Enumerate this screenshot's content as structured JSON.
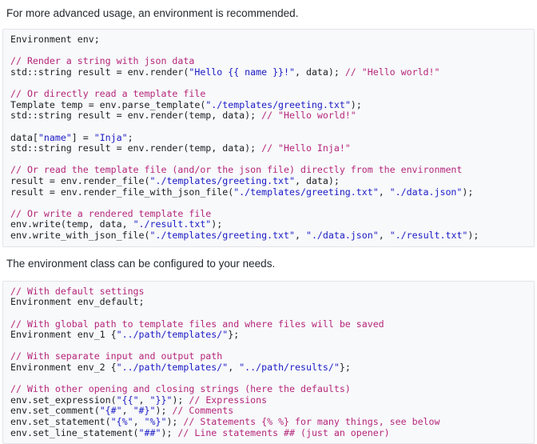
{
  "colors": {
    "comment": "#b5267a",
    "string": "#1a1ac4",
    "code_text": "#1b1f23",
    "body_text": "#24292e",
    "code_background": "#f8f9fb",
    "code_border": "#e2e4e8",
    "page_background": "#ffffff"
  },
  "paragraphs": {
    "intro": "For more advanced usage, an environment is recommended.",
    "configure": "The environment class can be configured to your needs."
  },
  "code_blocks": [
    {
      "name": "environment-usage-example",
      "language": "cpp",
      "lines": [
        [
          {
            "t": "p",
            "v": "Environment env;"
          }
        ],
        [],
        [
          {
            "t": "c",
            "v": "// Render a string with json data"
          }
        ],
        [
          {
            "t": "p",
            "v": "std::string result = env.render("
          },
          {
            "t": "s",
            "v": "\"Hello {{ name }}!\""
          },
          {
            "t": "p",
            "v": ", data); "
          },
          {
            "t": "c",
            "v": "// \"Hello world!\""
          }
        ],
        [],
        [
          {
            "t": "c",
            "v": "// Or directly read a template file"
          }
        ],
        [
          {
            "t": "p",
            "v": "Template temp = env.parse_template("
          },
          {
            "t": "s",
            "v": "\"./templates/greeting.txt\""
          },
          {
            "t": "p",
            "v": ");"
          }
        ],
        [
          {
            "t": "p",
            "v": "std::string result = env.render(temp, data); "
          },
          {
            "t": "c",
            "v": "// \"Hello world!\""
          }
        ],
        [],
        [
          {
            "t": "p",
            "v": "data["
          },
          {
            "t": "s",
            "v": "\"name\""
          },
          {
            "t": "p",
            "v": "] = "
          },
          {
            "t": "s",
            "v": "\"Inja\""
          },
          {
            "t": "p",
            "v": ";"
          }
        ],
        [
          {
            "t": "p",
            "v": "std::string result = env.render(temp, data); "
          },
          {
            "t": "c",
            "v": "// \"Hello Inja!\""
          }
        ],
        [],
        [
          {
            "t": "c",
            "v": "// Or read the template file (and/or the json file) directly from the environment"
          }
        ],
        [
          {
            "t": "p",
            "v": "result = env.render_file("
          },
          {
            "t": "s",
            "v": "\"./templates/greeting.txt\""
          },
          {
            "t": "p",
            "v": ", data);"
          }
        ],
        [
          {
            "t": "p",
            "v": "result = env.render_file_with_json_file("
          },
          {
            "t": "s",
            "v": "\"./templates/greeting.txt\""
          },
          {
            "t": "p",
            "v": ", "
          },
          {
            "t": "s",
            "v": "\"./data.json\""
          },
          {
            "t": "p",
            "v": ");"
          }
        ],
        [],
        [
          {
            "t": "c",
            "v": "// Or write a rendered template file"
          }
        ],
        [
          {
            "t": "p",
            "v": "env.write(temp, data, "
          },
          {
            "t": "s",
            "v": "\"./result.txt\""
          },
          {
            "t": "p",
            "v": ");"
          }
        ],
        [
          {
            "t": "p",
            "v": "env.write_with_json_file("
          },
          {
            "t": "s",
            "v": "\"./templates/greeting.txt\""
          },
          {
            "t": "p",
            "v": ", "
          },
          {
            "t": "s",
            "v": "\"./data.json\""
          },
          {
            "t": "p",
            "v": ", "
          },
          {
            "t": "s",
            "v": "\"./result.txt\""
          },
          {
            "t": "p",
            "v": ");"
          }
        ]
      ]
    },
    {
      "name": "environment-configuration-example",
      "language": "cpp",
      "lines": [
        [
          {
            "t": "c",
            "v": "// With default settings"
          }
        ],
        [
          {
            "t": "p",
            "v": "Environment env_default;"
          }
        ],
        [],
        [
          {
            "t": "c",
            "v": "// With global path to template files and where files will be saved"
          }
        ],
        [
          {
            "t": "p",
            "v": "Environment env_1 {"
          },
          {
            "t": "s",
            "v": "\"../path/templates/\""
          },
          {
            "t": "p",
            "v": "};"
          }
        ],
        [],
        [
          {
            "t": "c",
            "v": "// With separate input and output path"
          }
        ],
        [
          {
            "t": "p",
            "v": "Environment env_2 {"
          },
          {
            "t": "s",
            "v": "\"../path/templates/\""
          },
          {
            "t": "p",
            "v": ", "
          },
          {
            "t": "s",
            "v": "\"../path/results/\""
          },
          {
            "t": "p",
            "v": "};"
          }
        ],
        [],
        [
          {
            "t": "c",
            "v": "// With other opening and closing strings (here the defaults)"
          }
        ],
        [
          {
            "t": "p",
            "v": "env.set_expression("
          },
          {
            "t": "s",
            "v": "\"{{\""
          },
          {
            "t": "p",
            "v": ", "
          },
          {
            "t": "s",
            "v": "\"}}\""
          },
          {
            "t": "p",
            "v": "); "
          },
          {
            "t": "c",
            "v": "// Expressions"
          }
        ],
        [
          {
            "t": "p",
            "v": "env.set_comment("
          },
          {
            "t": "s",
            "v": "\"{#\""
          },
          {
            "t": "p",
            "v": ", "
          },
          {
            "t": "s",
            "v": "\"#}\""
          },
          {
            "t": "p",
            "v": "); "
          },
          {
            "t": "c",
            "v": "// Comments"
          }
        ],
        [
          {
            "t": "p",
            "v": "env.set_statement("
          },
          {
            "t": "s",
            "v": "\"{%\""
          },
          {
            "t": "p",
            "v": ", "
          },
          {
            "t": "s",
            "v": "\"%}\""
          },
          {
            "t": "p",
            "v": "); "
          },
          {
            "t": "c",
            "v": "// Statements {% %} for many things, see below"
          }
        ],
        [
          {
            "t": "p",
            "v": "env.set_line_statement("
          },
          {
            "t": "s",
            "v": "\"##\""
          },
          {
            "t": "p",
            "v": "); "
          },
          {
            "t": "c",
            "v": "// Line statements ## (just an opener)"
          }
        ]
      ]
    }
  ]
}
